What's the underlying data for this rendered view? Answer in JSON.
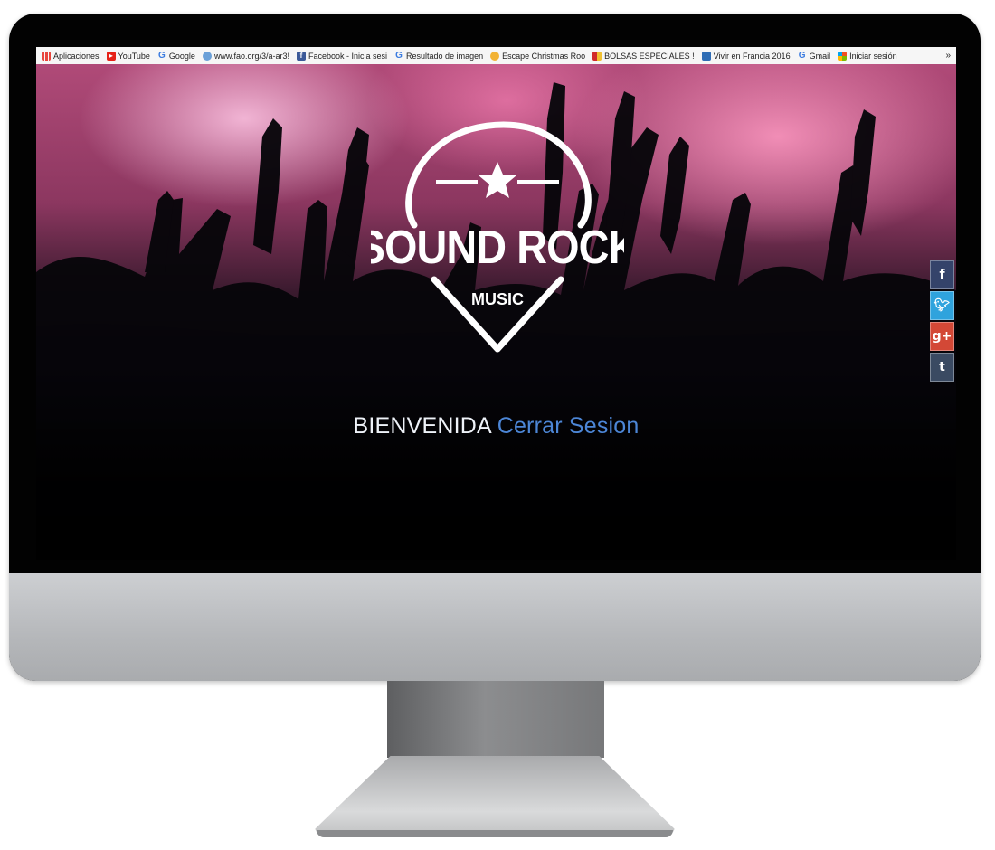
{
  "bookmarks": [
    {
      "label": "Aplicaciones",
      "icon": "apps-grid-icon"
    },
    {
      "label": "YouTube",
      "icon": "youtube-icon"
    },
    {
      "label": "Google",
      "icon": "google-icon"
    },
    {
      "label": "www.fao.org/3/a-ar3!",
      "icon": "globe-icon"
    },
    {
      "label": "Facebook - Inicia sesi",
      "icon": "facebook-icon"
    },
    {
      "label": "Resultado de imagen",
      "icon": "google-icon"
    },
    {
      "label": "Escape Christmas Roo",
      "icon": "smiley-icon"
    },
    {
      "label": "BOLSAS ESPECIALES !",
      "icon": "bolsas-icon"
    },
    {
      "label": "Vivir en Francia 2016",
      "icon": "vivir-icon"
    },
    {
      "label": "Gmail",
      "icon": "google-icon"
    },
    {
      "label": "Iniciar sesión",
      "icon": "microsoft-icon"
    }
  ],
  "bookmarks_more": "»",
  "logo": {
    "title": "SOUND ROCK",
    "subtitle": "MUSIC"
  },
  "welcome": {
    "text": "BIENVENIDA",
    "logout_link": "Cerrar Sesion"
  },
  "social": [
    {
      "name": "facebook",
      "glyph": "f",
      "color": "#34436a"
    },
    {
      "name": "twitter",
      "glyph": "t",
      "color": "#2fa3dd"
    },
    {
      "name": "google-plus",
      "glyph": "g+",
      "color": "#d34836"
    },
    {
      "name": "tumblr",
      "glyph": "t",
      "color": "#3a4a62"
    }
  ]
}
